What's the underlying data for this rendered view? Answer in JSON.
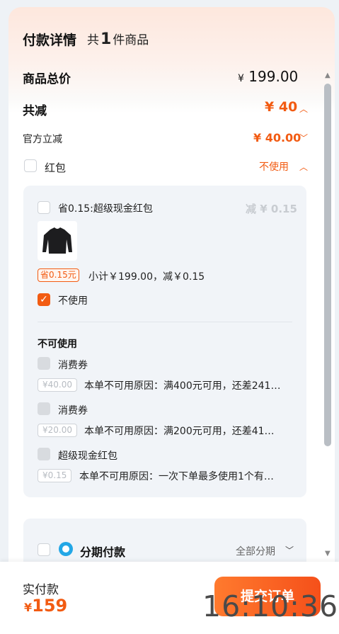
{
  "header": {
    "title": "付款详情",
    "count_prefix": "共",
    "count": "1",
    "count_suffix": "件商品"
  },
  "total": {
    "label": "商品总价",
    "currency": "¥",
    "amount": "199.00"
  },
  "discount": {
    "label": "共减",
    "value": "¥ 40"
  },
  "official": {
    "label": "官方立减",
    "value": "¥ 40.00"
  },
  "redpacket": {
    "label": "红包",
    "status": "不使用",
    "option": {
      "label": "省0.15:超级现金红包",
      "reduce": "减 ¥ 0.15",
      "tag": "省0.15元",
      "subtotal": "小计￥199.00，减￥0.15"
    },
    "no_use": "不使用",
    "unavailable_title": "不可使用",
    "unavailable": [
      {
        "name": "消费券",
        "amount": "¥40.00",
        "reason": "本单不可用原因：满400元可用，还差241…"
      },
      {
        "name": "消费券",
        "amount": "¥20.00",
        "reason": "本单不可用原因：满200元可用，还差41…"
      },
      {
        "name": "超级现金红包",
        "amount": "¥0.15",
        "reason": "本单不可用原因：一次下单最多使用1个有…"
      }
    ]
  },
  "installment": {
    "label": "分期付款",
    "option": "全部分期"
  },
  "footer": {
    "pay_label": "实付款",
    "currency": "¥",
    "amount": "159",
    "submit": "提交订单"
  },
  "overlay_clock": "16:10:36",
  "colors": {
    "accent": "#f25b12",
    "background": "#eef2f6"
  }
}
